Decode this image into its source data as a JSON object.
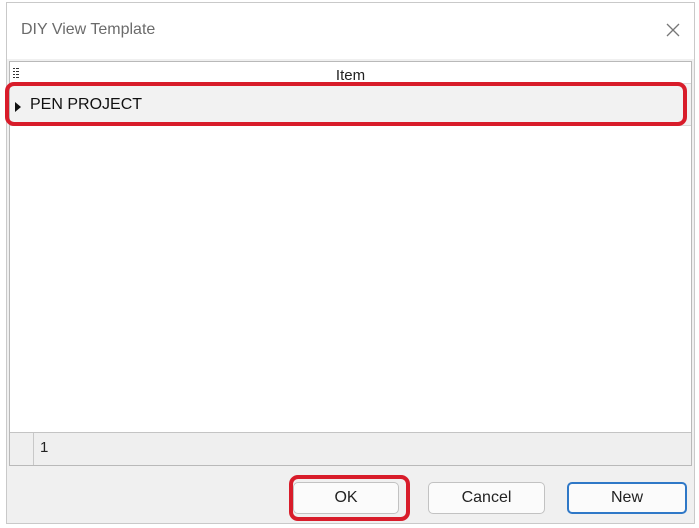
{
  "dialog": {
    "title": "DIY View Template",
    "close_icon": "close-icon"
  },
  "grid": {
    "header_icon": "column-chooser-icon",
    "column_header": "Item",
    "rows": [
      {
        "label": "PEN PROJECT",
        "expand_icon": "triangle-right-icon",
        "highlighted": true
      }
    ],
    "footer_count": "1"
  },
  "buttons": {
    "ok": "OK",
    "cancel": "Cancel",
    "new": "New"
  },
  "colors": {
    "highlight": "#d81c2a",
    "default_button_border": "#2f78c7"
  }
}
